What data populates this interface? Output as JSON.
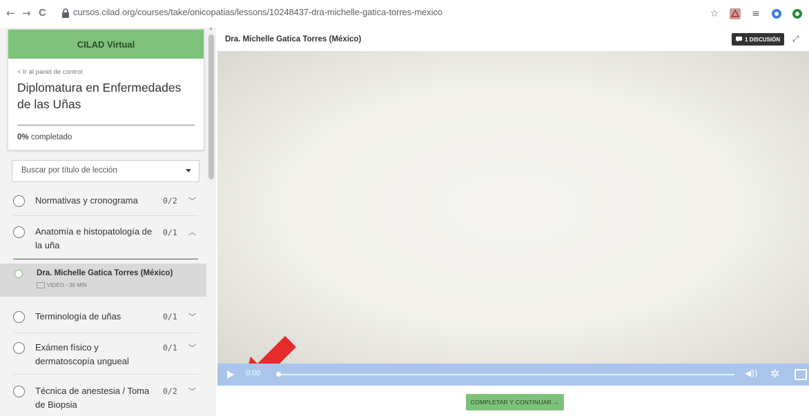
{
  "browser": {
    "back": "←",
    "forward": "→",
    "reload": "C",
    "url": "cursos.cilad.org/courses/take/onicopatias/lessons/10248437-dra-michelle-gatica-torres-mexico",
    "icons": [
      "star-icon",
      "pdf-extension-icon",
      "reading-list-icon",
      "extension-icon",
      "extension-icon"
    ]
  },
  "sidebar": {
    "brand": "CILAD Virtual",
    "back_link": "< Ir al panel de control",
    "course_title": "Diplomatura en Enfermedades de las Uñas",
    "progress_percent": 0,
    "progress_value": "0%",
    "progress_label": " completado",
    "search_placeholder": "Buscar por título de lección",
    "sections": [
      {
        "title": "Normativas y cronograma",
        "count": "0/2",
        "expanded": false
      },
      {
        "title": "Anatomía e histopatología de la uña",
        "count": "0/1",
        "expanded": true
      },
      {
        "title": "Terminología de uñas",
        "count": "0/1",
        "expanded": false
      },
      {
        "title": "Exámen físico y dermatoscopía ungueal",
        "count": "0/1",
        "expanded": false
      },
      {
        "title": "Técnica de anestesia / Toma de Biopsia",
        "count": "0/2",
        "expanded": false
      }
    ],
    "active_lesson": {
      "title": "Dra. Michelle Gatica Torres (México)",
      "meta": "VIDEO - 36 MIN"
    }
  },
  "main": {
    "lesson_title": "Dra. Michelle Gatica Torres (México)",
    "discussion_label": "1 DISCUSIÓN",
    "video": {
      "time": "0:00",
      "progress_fraction": 0
    },
    "complete_button": "COMPLETAR Y CONTINUAR →"
  },
  "colors": {
    "accent_green": "#7ec17a",
    "controls_blue": "#a9c6ea",
    "annotation_red": "#e52b2b"
  }
}
